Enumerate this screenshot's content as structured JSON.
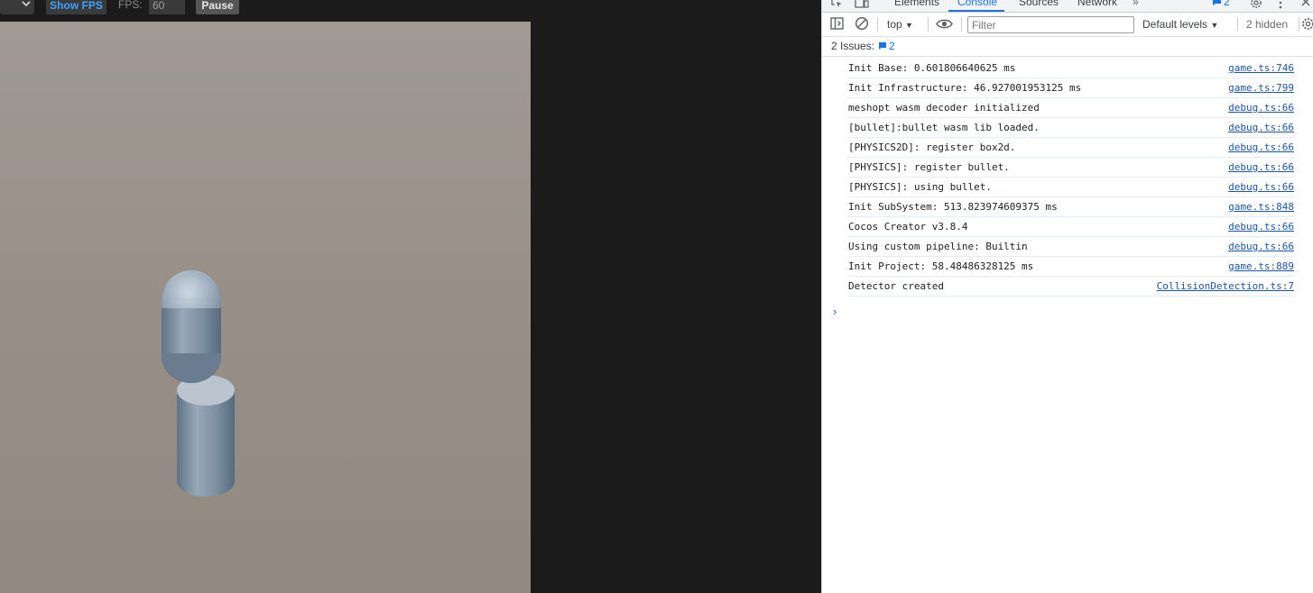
{
  "toolbar": {
    "show_fps_label": "Show FPS",
    "fps_label": "FPS:",
    "fps_value": "60",
    "pause_label": "Pause"
  },
  "devtools": {
    "tabs": [
      {
        "label": "Elements"
      },
      {
        "label": "Console",
        "active": true
      },
      {
        "label": "Sources"
      },
      {
        "label": "Network"
      }
    ],
    "more_tabs": "»",
    "issue_badge_count": "2",
    "console_bar": {
      "context": "top",
      "filter_placeholder": "Filter",
      "levels": "Default levels",
      "hidden": "2 hidden"
    },
    "issues": {
      "label": "2 Issues:",
      "count": "2"
    },
    "logs": [
      {
        "msg": "Init Base: 0.601806640625 ms",
        "src": "game.ts:746"
      },
      {
        "msg": "Init Infrastructure: 46.927001953125 ms",
        "src": "game.ts:799"
      },
      {
        "msg": "meshopt wasm decoder initialized",
        "src": "debug.ts:66"
      },
      {
        "msg": "[bullet]:bullet wasm lib loaded.",
        "src": "debug.ts:66"
      },
      {
        "msg": "[PHYSICS2D]: register box2d.",
        "src": "debug.ts:66"
      },
      {
        "msg": "[PHYSICS]: register bullet.",
        "src": "debug.ts:66"
      },
      {
        "msg": "[PHYSICS]: using bullet.",
        "src": "debug.ts:66"
      },
      {
        "msg": "Init SubSystem: 513.823974609375 ms",
        "src": "game.ts:848"
      },
      {
        "msg": "Cocos Creator v3.8.4",
        "src": "debug.ts:66"
      },
      {
        "msg": "Using custom pipeline: Builtin",
        "src": "debug.ts:66"
      },
      {
        "msg": "Init Project: 58.48486328125 ms",
        "src": "game.ts:889"
      },
      {
        "msg": "Detector created",
        "src": "CollisionDetection.ts:7"
      }
    ],
    "prompt": "›"
  },
  "icons": [
    "chevron-down-icon",
    "inspect-icon",
    "device-toolbar-icon",
    "message-icon",
    "settings-icon",
    "more-vert-icon",
    "close-icon",
    "sidebar-toggle-icon",
    "clear-console-icon",
    "eye-icon"
  ],
  "colors": {
    "accent": "#1a73e8",
    "link": "#1a55a8",
    "fps_blue": "#3da5ff",
    "viewport": "#978e85"
  }
}
